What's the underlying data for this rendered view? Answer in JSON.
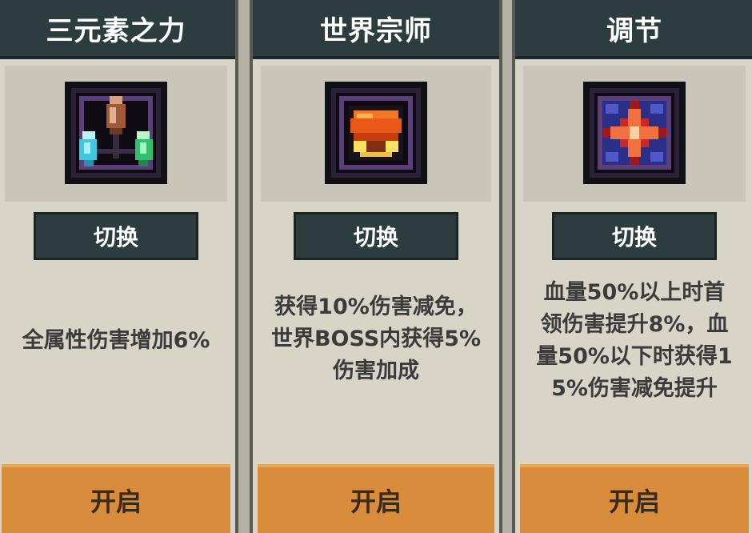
{
  "cards": [
    {
      "title": "三元素之力",
      "icon": "three-elements-icon",
      "switch_label": "切换",
      "description_lines": [
        "全属性伤害增加6%"
      ],
      "open_label": "开启"
    },
    {
      "title": "世界宗师",
      "icon": "world-master-icon",
      "switch_label": "切换",
      "description_lines": [
        "获得10%伤害减免，",
        "世界BOSS内获得5%",
        "伤害加成"
      ],
      "open_label": "开启"
    },
    {
      "title": "调节",
      "icon": "adjust-icon",
      "switch_label": "切换",
      "description_lines": [
        "血量50%以上时首",
        "领伤害提升8%，血",
        "量50%以下时获得1",
        "5%伤害减免提升"
      ],
      "open_label": "开启"
    }
  ],
  "colors": {
    "header_bg": "#2c3c3f",
    "panel_bg": "#d8d4c8",
    "open_button": "#d98c3c",
    "text_dark": "#3b3b3b"
  }
}
